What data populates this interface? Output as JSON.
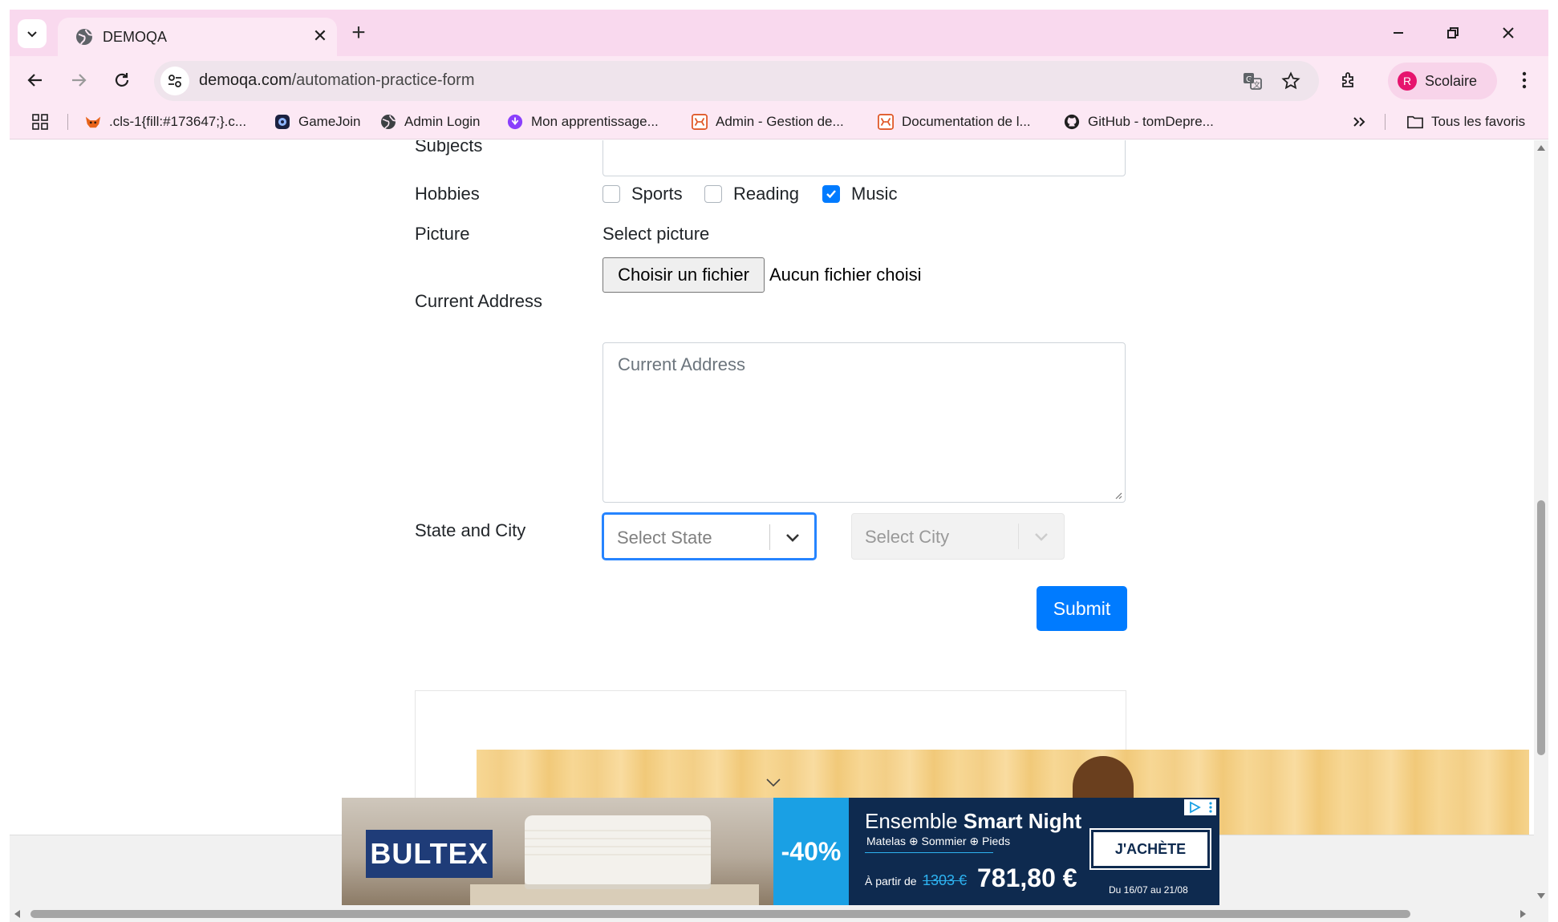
{
  "browser": {
    "tab_title": "DEMOQA",
    "url_domain": "demoqa.com",
    "url_path": "/automation-practice-form",
    "profile_initial": "R",
    "profile_name": "Scolaire",
    "accent_color": "#f9d9ee"
  },
  "bookmarks": {
    "items": [
      {
        "label": ".cls-1{fill:#173647;}.c...",
        "icon": "fox-icon"
      },
      {
        "label": "GameJoin",
        "icon": "gamejoin-icon"
      },
      {
        "label": "Admin Login",
        "icon": "globe-icon"
      },
      {
        "label": "Mon apprentissage...",
        "icon": "learning-icon"
      },
      {
        "label": "Admin - Gestion de...",
        "icon": "app-icon"
      },
      {
        "label": "Documentation de l...",
        "icon": "app-icon"
      },
      {
        "label": "GitHub - tomDepre...",
        "icon": "github-icon"
      }
    ],
    "all_bookmarks": "Tous les favoris"
  },
  "form": {
    "subjects_label": "Subjects",
    "hobbies_label": "Hobbies",
    "hobbies": [
      {
        "label": "Sports",
        "checked": false
      },
      {
        "label": "Reading",
        "checked": false
      },
      {
        "label": "Music",
        "checked": true
      }
    ],
    "picture_label": "Picture",
    "select_picture": "Select picture",
    "file_button": "Choisir un fichier",
    "file_status": "Aucun fichier choisi",
    "address_label": "Current Address",
    "address_placeholder": "Current Address",
    "state_city_label": "State and City",
    "state_placeholder": "Select State",
    "city_placeholder": "Select City",
    "submit": "Submit",
    "primary_color": "#007bff"
  },
  "ad": {
    "brand": "BULTEX",
    "discount": "-40%",
    "title_plain": "Ensemble ",
    "title_bold": "Smart Night",
    "subtitle": "Matelas ⊕ Sommier ⊕ Pieds",
    "from_label": "À partir de",
    "old_price": "1303 €",
    "price": "781,80 €",
    "cta": "J'ACHÈTE",
    "dates": "Du 16/07 au 21/08"
  }
}
